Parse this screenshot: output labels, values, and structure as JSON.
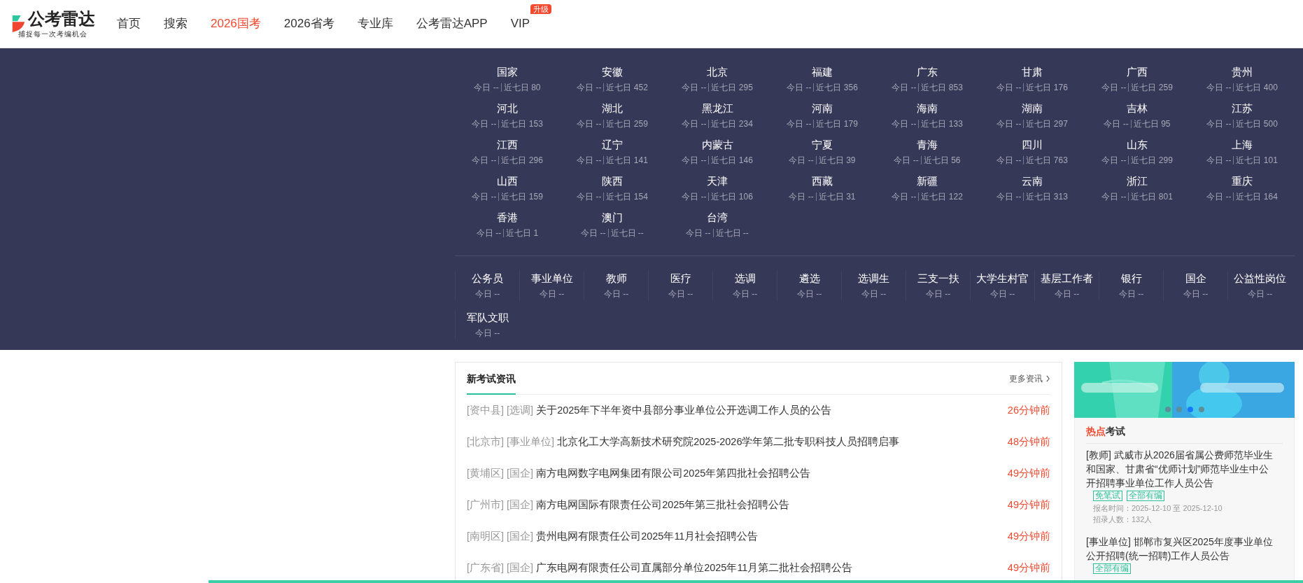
{
  "header": {
    "logo": {
      "name": "公考雷达",
      "slogan": "捕捉每一次考编机会"
    },
    "nav": [
      {
        "label": "首页",
        "selected": false
      },
      {
        "label": "搜索",
        "selected": false
      },
      {
        "label": "2026国考",
        "selected": true
      },
      {
        "label": "2026省考",
        "selected": false
      },
      {
        "label": "专业库",
        "selected": false
      },
      {
        "label": "公考雷达APP",
        "selected": false
      },
      {
        "label": "VIP",
        "selected": false,
        "badge": "升级"
      }
    ]
  },
  "provinces": [
    {
      "name": "国家",
      "today": "今日 --",
      "week": "近七日 80"
    },
    {
      "name": "安徽",
      "today": "今日 --",
      "week": "近七日 452"
    },
    {
      "name": "北京",
      "today": "今日 --",
      "week": "近七日 295"
    },
    {
      "name": "福建",
      "today": "今日 --",
      "week": "近七日 356"
    },
    {
      "name": "广东",
      "today": "今日 --",
      "week": "近七日 853"
    },
    {
      "name": "甘肃",
      "today": "今日 --",
      "week": "近七日 176"
    },
    {
      "name": "广西",
      "today": "今日 --",
      "week": "近七日 259"
    },
    {
      "name": "贵州",
      "today": "今日 --",
      "week": "近七日 400"
    },
    {
      "name": "河北",
      "today": "今日 --",
      "week": "近七日 153"
    },
    {
      "name": "湖北",
      "today": "今日 --",
      "week": "近七日 259"
    },
    {
      "name": "黑龙江",
      "today": "今日 --",
      "week": "近七日 234"
    },
    {
      "name": "河南",
      "today": "今日 --",
      "week": "近七日 179"
    },
    {
      "name": "海南",
      "today": "今日 --",
      "week": "近七日 133"
    },
    {
      "name": "湖南",
      "today": "今日 --",
      "week": "近七日 297"
    },
    {
      "name": "吉林",
      "today": "今日 --",
      "week": "近七日 95"
    },
    {
      "name": "江苏",
      "today": "今日 --",
      "week": "近七日 500"
    },
    {
      "name": "江西",
      "today": "今日 --",
      "week": "近七日 296"
    },
    {
      "name": "辽宁",
      "today": "今日 --",
      "week": "近七日 141"
    },
    {
      "name": "内蒙古",
      "today": "今日 --",
      "week": "近七日 146"
    },
    {
      "name": "宁夏",
      "today": "今日 --",
      "week": "近七日 39"
    },
    {
      "name": "青海",
      "today": "今日 --",
      "week": "近七日 56"
    },
    {
      "name": "四川",
      "today": "今日 --",
      "week": "近七日 763"
    },
    {
      "name": "山东",
      "today": "今日 --",
      "week": "近七日 299"
    },
    {
      "name": "上海",
      "today": "今日 --",
      "week": "近七日 101"
    },
    {
      "name": "山西",
      "today": "今日 --",
      "week": "近七日 159"
    },
    {
      "name": "陕西",
      "today": "今日 --",
      "week": "近七日 154"
    },
    {
      "name": "天津",
      "today": "今日 --",
      "week": "近七日 106"
    },
    {
      "name": "西藏",
      "today": "今日 --",
      "week": "近七日 31"
    },
    {
      "name": "新疆",
      "today": "今日 --",
      "week": "近七日 122"
    },
    {
      "name": "云南",
      "today": "今日 --",
      "week": "近七日 313"
    },
    {
      "name": "浙江",
      "today": "今日 --",
      "week": "近七日 801"
    },
    {
      "name": "重庆",
      "today": "今日 --",
      "week": "近七日 164"
    },
    {
      "name": "香港",
      "today": "今日 --",
      "week": "近七日 1"
    },
    {
      "name": "澳门",
      "today": "今日 --",
      "week": "近七日 --"
    },
    {
      "name": "台湾",
      "today": "今日 --",
      "week": "近七日 --"
    }
  ],
  "categories": [
    {
      "name": "公务员",
      "today": "今日 --"
    },
    {
      "name": "事业单位",
      "today": "今日 --"
    },
    {
      "name": "教师",
      "today": "今日 --"
    },
    {
      "name": "医疗",
      "today": "今日 --"
    },
    {
      "name": "选调",
      "today": "今日 --"
    },
    {
      "name": "遴选",
      "today": "今日 --"
    },
    {
      "name": "选调生",
      "today": "今日 --"
    },
    {
      "name": "三支一扶",
      "today": "今日 --"
    },
    {
      "name": "大学生村官",
      "today": "今日 --"
    },
    {
      "name": "基层工作者",
      "today": "今日 --"
    },
    {
      "name": "银行",
      "today": "今日 --"
    },
    {
      "name": "国企",
      "today": "今日 --"
    },
    {
      "name": "公益性岗位",
      "today": "今日 --"
    },
    {
      "name": "军队文职",
      "today": "今日 --"
    }
  ],
  "news": {
    "title": "新考试资讯",
    "more": "更多资讯",
    "items": [
      {
        "tags": [
          "[资中县]",
          "[选调]"
        ],
        "title": "关于2025年下半年资中县部分事业单位公开选调工作人员的公告",
        "time": "26分钟前"
      },
      {
        "tags": [
          "[北京市]",
          "[事业单位]"
        ],
        "title": "北京化工大学高新技术研究院2025-2026学年第二批专职科技人员招聘启事",
        "time": "48分钟前"
      },
      {
        "tags": [
          "[黄埔区]",
          "[国企]"
        ],
        "title": "南方电网数字电网集团有限公司2025年第四批社会招聘公告",
        "time": "49分钟前"
      },
      {
        "tags": [
          "[广州市]",
          "[国企]"
        ],
        "title": "南方电网国际有限责任公司2025年第三批社会招聘公告",
        "time": "49分钟前"
      },
      {
        "tags": [
          "[南明区]",
          "[国企]"
        ],
        "title": "贵州电网有限责任公司2025年11月社会招聘公告",
        "time": "49分钟前"
      },
      {
        "tags": [
          "[广东省]",
          "[国企]"
        ],
        "title": "广东电网有限责任公司直属部分单位2025年11月第二批社会招聘公告",
        "time": "49分钟前"
      }
    ]
  },
  "page_progress": {
    "level": 0.84
  },
  "banner": {
    "kind": "picture",
    "dots": [
      {
        "selected": false
      },
      {
        "selected": false
      },
      {
        "selected": true
      },
      {
        "selected": false
      }
    ]
  },
  "hot": {
    "title": "**热点**考试",
    "items": [
      {
        "category": "[教师]",
        "title": "武威市从2026届省属公费师范毕业生和国家、甘肃省“优师计划”师范毕业生中公开招聘事业单位工作人员公告",
        "tags": [
          "免笔试",
          "全部有编"
        ],
        "details": [
          "报名时间：2025-12-10 至 2025-12-10",
          "招录人数：132人"
        ]
      },
      {
        "category": "[事业单位]",
        "title": "邯郸市复兴区2025年度事业单位公开招聘(统一招聘)工作人员公告",
        "tags": [
          "全部有编"
        ]
      }
    ]
  }
}
